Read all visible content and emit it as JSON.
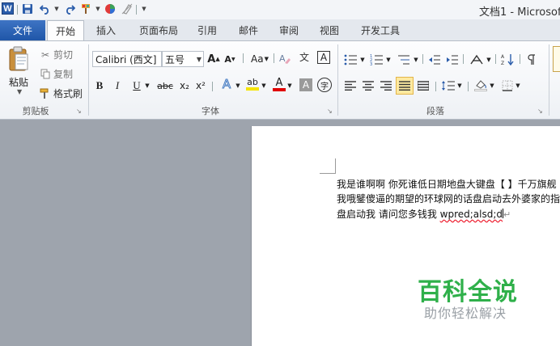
{
  "window": {
    "title": "文档1 - Microsoft"
  },
  "quick_access": {
    "app_icon_letter": "W"
  },
  "tabs": {
    "file": "文件",
    "items": [
      "开始",
      "插入",
      "页面布局",
      "引用",
      "邮件",
      "审阅",
      "视图",
      "开发工具"
    ],
    "active": "开始"
  },
  "clipboard": {
    "paste": "粘贴",
    "cut": "剪切",
    "copy": "复制",
    "format_painter": "格式刷",
    "group_label": "剪贴板"
  },
  "font": {
    "font_name": "Calibri (西文]",
    "font_size": "五号",
    "grow_label": "A",
    "shrink_label": "A",
    "case_label": "Aa",
    "bold": "B",
    "italic": "I",
    "underline": "U",
    "strike": "abc",
    "subscript": "x₂",
    "superscript": "x²",
    "effects": "A",
    "highlight": "ab",
    "font_color": "A",
    "char_shading": "A",
    "enclose": "字",
    "phonetic": "文",
    "char_border": "A",
    "group_label": "字体",
    "colors": {
      "highlight": "#f5e400",
      "font_color": "#e00000"
    }
  },
  "paragraph": {
    "group_label": "段落"
  },
  "document": {
    "lines": [
      "我是谁啊啊 你死谁低日期地盘大键盘【 】千万旗舰",
      "我哦鐾傻逼的期望的环球网的话盘启动去外婆家的指",
      "盘启动我 请问您多钱我 "
    ],
    "misspelled": "wpred;alsd;d",
    "pilcrow": "↵"
  },
  "watermark": {
    "title": "百科全说",
    "subtitle": "助你轻松解决"
  }
}
